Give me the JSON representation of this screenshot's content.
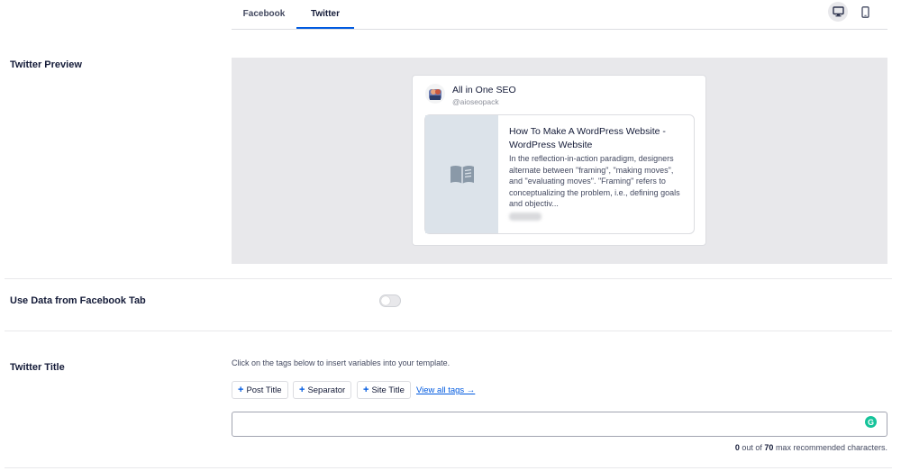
{
  "tabs": [
    {
      "label": "Facebook",
      "active": false
    },
    {
      "label": "Twitter",
      "active": true
    }
  ],
  "device_toggle": {
    "desktop_icon": "desktop-icon",
    "mobile_icon": "mobile-icon",
    "selected": "desktop"
  },
  "twitter_preview": {
    "label": "Twitter Preview",
    "account_name": "All in One SEO",
    "account_handle": "@aioseopack",
    "post_title": "How To Make A WordPress Website - WordPress Website",
    "post_description": "In the reflection-in-action paradigm, designers alternate between \"framing\", \"making moves\", and \"evaluating moves\". \"Framing\" refers to conceptualizing the problem, i.e., defining goals and objectiv...",
    "thumbnail_icon": "book-icon"
  },
  "use_facebook_data": {
    "label": "Use Data from Facebook Tab",
    "enabled": false
  },
  "twitter_title": {
    "label": "Twitter Title",
    "help_text": "Click on the tags below to insert variables into your template.",
    "tags": [
      "Post Title",
      "Separator",
      "Site Title"
    ],
    "view_all_label": "View all tags →",
    "input_value": "",
    "char_count": "0",
    "char_max": "70",
    "count_prefix": "out of",
    "count_suffix": "max recommended characters."
  },
  "colors": {
    "accent": "#005ae0",
    "preview_bg": "#e8e8eb",
    "grammarly": "#15c39a"
  }
}
